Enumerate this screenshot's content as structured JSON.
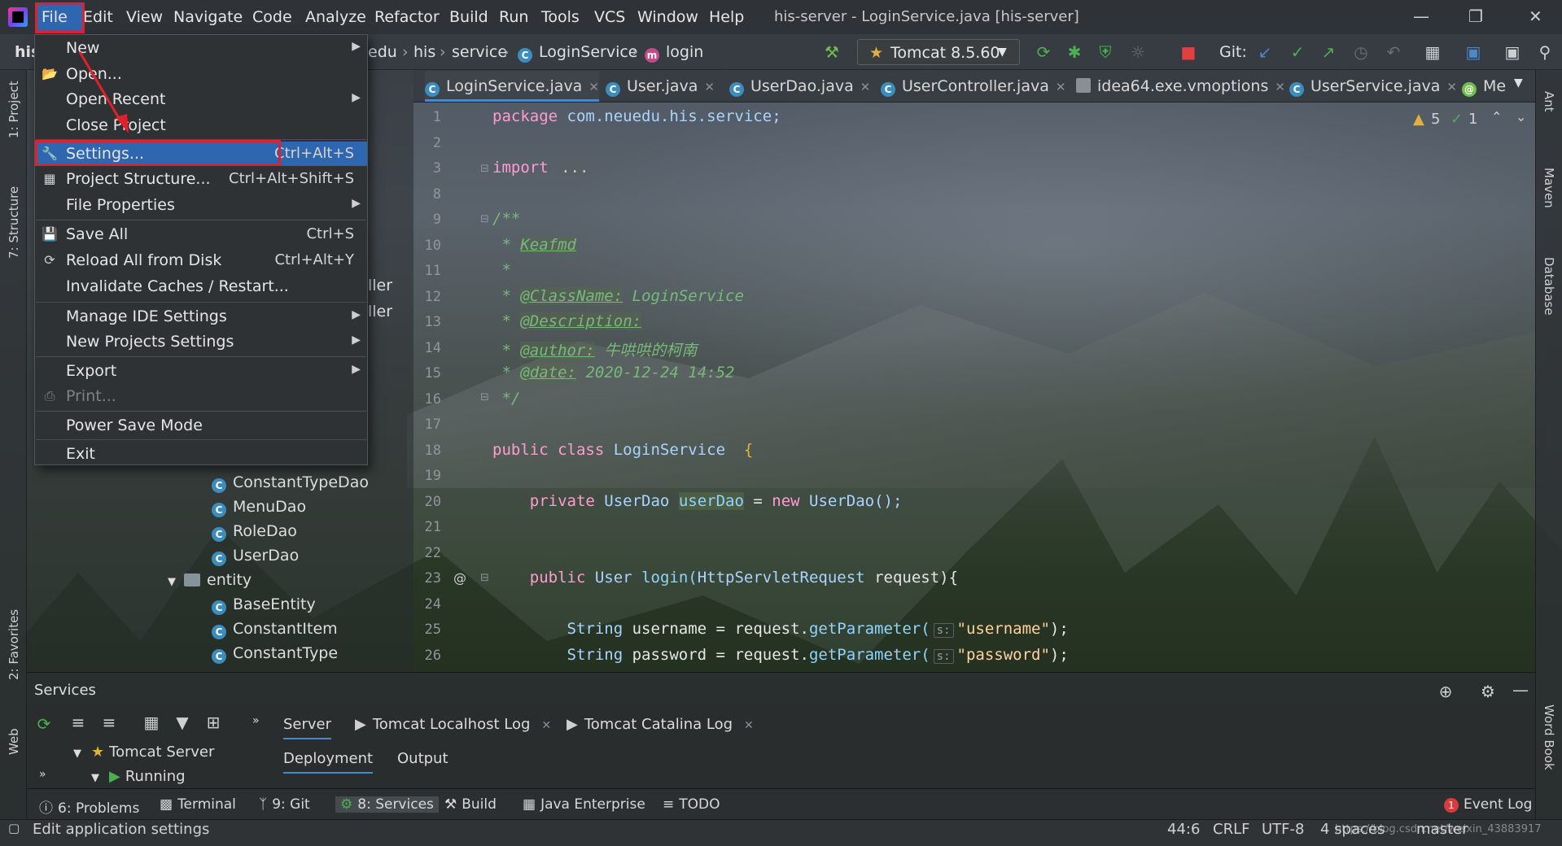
{
  "menubar": {
    "items": [
      "File",
      "Edit",
      "View",
      "Navigate",
      "Code",
      "Analyze",
      "Refactor",
      "Build",
      "Run",
      "Tools",
      "VCS",
      "Window",
      "Help"
    ],
    "window_title": "his-server - LoginService.java [his-server]"
  },
  "navbar": {
    "project": "his",
    "breadcrumbs": [
      "edu",
      "his",
      "service",
      "LoginService",
      "login"
    ],
    "run_config": "Tomcat 8.5.60",
    "git_label": "Git:"
  },
  "file_menu": {
    "items": [
      {
        "label": "New",
        "shortcut": "",
        "submenu": true
      },
      {
        "label": "Open...",
        "shortcut": "",
        "submenu": false
      },
      {
        "label": "Open Recent",
        "shortcut": "",
        "submenu": true
      },
      {
        "label": "Close Project",
        "shortcut": "",
        "submenu": false
      },
      {
        "label": "Settings...",
        "shortcut": "Ctrl+Alt+S",
        "submenu": false
      },
      {
        "label": "Project Structure...",
        "shortcut": "Ctrl+Alt+Shift+S",
        "submenu": false
      },
      {
        "label": "File Properties",
        "shortcut": "",
        "submenu": true
      },
      {
        "label": "Save All",
        "shortcut": "Ctrl+S",
        "submenu": false
      },
      {
        "label": "Reload All from Disk",
        "shortcut": "Ctrl+Alt+Y",
        "submenu": false
      },
      {
        "label": "Invalidate Caches / Restart...",
        "shortcut": "",
        "submenu": false
      },
      {
        "label": "Manage IDE Settings",
        "shortcut": "",
        "submenu": true
      },
      {
        "label": "New Projects Settings",
        "shortcut": "",
        "submenu": true
      },
      {
        "label": "Export",
        "shortcut": "",
        "submenu": true
      },
      {
        "label": "Print...",
        "shortcut": "",
        "submenu": false
      },
      {
        "label": "Power Save Mode",
        "shortcut": "",
        "submenu": false
      },
      {
        "label": "Exit",
        "shortcut": "",
        "submenu": false
      }
    ]
  },
  "project_tree": {
    "partial": [
      "ller",
      "ller"
    ],
    "items": [
      "ConstantTypeDao",
      "MenuDao",
      "RoleDao",
      "UserDao",
      "entity",
      "BaseEntity",
      "ConstantItem",
      "ConstantType"
    ]
  },
  "editor_tabs": [
    "LoginService.java",
    "User.java",
    "UserDao.java",
    "UserController.java",
    "idea64.exe.vmoptions",
    "UserService.java",
    "Me"
  ],
  "inspections": {
    "warnings": "5",
    "ok": "1"
  },
  "code": {
    "line_numbers": [
      "1",
      "2",
      "3",
      "8",
      "9",
      "10",
      "11",
      "12",
      "13",
      "14",
      "15",
      "16",
      "17",
      "18",
      "19",
      "20",
      "21",
      "22",
      "23",
      "24",
      "25",
      "26"
    ],
    "package_kw": "package",
    "package_name": "com.neuedu.his.service;",
    "import_kw": "import",
    "import_fold": "...",
    "doc_open": "/**",
    "doc_name": "Keafmd",
    "doc_star": "*",
    "class_tag": "@ClassName:",
    "class_val": "LoginService",
    "desc_tag": "@Description:",
    "author_tag": "@author:",
    "author_val": "牛哄哄的柯南",
    "date_tag": "@date:",
    "date_val": "2020-12-24 14:52",
    "doc_close": "*/",
    "class_decl_kw": "public class",
    "class_decl_name": "LoginService",
    "class_decl_brace": "{",
    "field_kw": "private",
    "field_type": "UserDao",
    "field_name": "userDao",
    "field_eq": "=",
    "field_new": "new",
    "field_init": "UserDao();",
    "method_annot": "@",
    "method_kw": "public",
    "method_type": "User",
    "method_name": "login(",
    "method_param_type": "HttpServletRequest",
    "method_param": "request){",
    "l25_type": "String",
    "l25_var": "username = request.",
    "l25_call": "getParameter(",
    "l25_hint": "s:",
    "l25_str": "\"username\"",
    "l25_end": ");",
    "l26_type": "String",
    "l26_var": "password = request.",
    "l26_call": "getParameter(",
    "l26_hint": "s:",
    "l26_str": "\"password\"",
    "l26_end": ");"
  },
  "services": {
    "title": "Services",
    "tabs": [
      "Server",
      "Tomcat Localhost Log",
      "Tomcat Catalina Log"
    ],
    "subtabs": [
      "Deployment",
      "Output"
    ],
    "tree": [
      "Tomcat Server",
      "Running"
    ]
  },
  "left_strip": [
    "1: Project",
    "7: Structure",
    "2: Favorites",
    "Web"
  ],
  "right_strip": [
    "Ant",
    "Maven",
    "Database",
    "Word Book"
  ],
  "toolwindows": [
    "6: Problems",
    "Terminal",
    "9: Git",
    "8: Services",
    "Build",
    "Java Enterprise",
    "TODO"
  ],
  "event_log": {
    "count": "1",
    "label": "Event Log"
  },
  "status": {
    "message": "Edit application settings",
    "position": "44:6",
    "line_sep": "CRLF",
    "encoding": "UTF-8",
    "indent": "4 spaces",
    "branch": "master",
    "watermark": "https://blog.csdn.net/weixin_43883917"
  },
  "colors": {
    "accent": "#2e67b0",
    "annotation_red": "#e0202a"
  }
}
